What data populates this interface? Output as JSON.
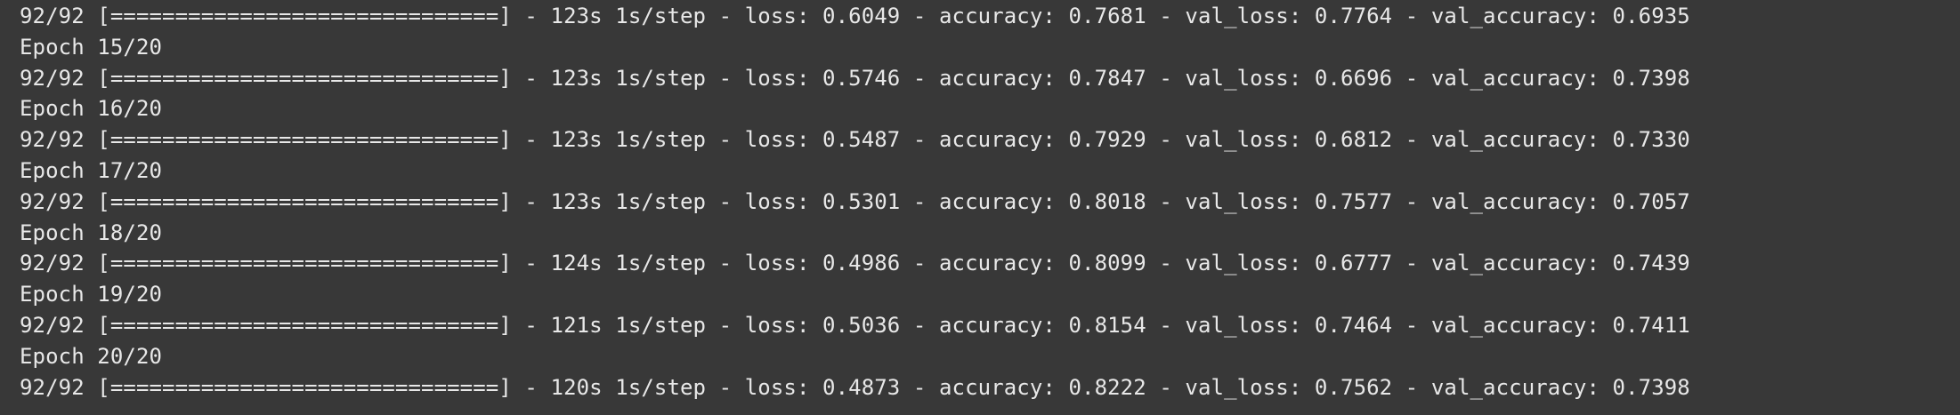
{
  "terminal": {
    "lines": [
      "92/92 [==============================] - 123s 1s/step - loss: 0.6049 - accuracy: 0.7681 - val_loss: 0.7764 - val_accuracy: 0.6935",
      "Epoch 15/20",
      "92/92 [==============================] - 123s 1s/step - loss: 0.5746 - accuracy: 0.7847 - val_loss: 0.6696 - val_accuracy: 0.7398",
      "Epoch 16/20",
      "92/92 [==============================] - 123s 1s/step - loss: 0.5487 - accuracy: 0.7929 - val_loss: 0.6812 - val_accuracy: 0.7330",
      "Epoch 17/20",
      "92/92 [==============================] - 123s 1s/step - loss: 0.5301 - accuracy: 0.8018 - val_loss: 0.7577 - val_accuracy: 0.7057",
      "Epoch 18/20",
      "92/92 [==============================] - 124s 1s/step - loss: 0.4986 - accuracy: 0.8099 - val_loss: 0.6777 - val_accuracy: 0.7439",
      "Epoch 19/20",
      "92/92 [==============================] - 121s 1s/step - loss: 0.5036 - accuracy: 0.8154 - val_loss: 0.7464 - val_accuracy: 0.7411",
      "Epoch 20/20",
      "92/92 [==============================] - 120s 1s/step - loss: 0.4873 - accuracy: 0.8222 - val_loss: 0.7562 - val_accuracy: 0.7398"
    ]
  },
  "colors": {
    "background": "#383838",
    "text": "#e8e8e8"
  }
}
